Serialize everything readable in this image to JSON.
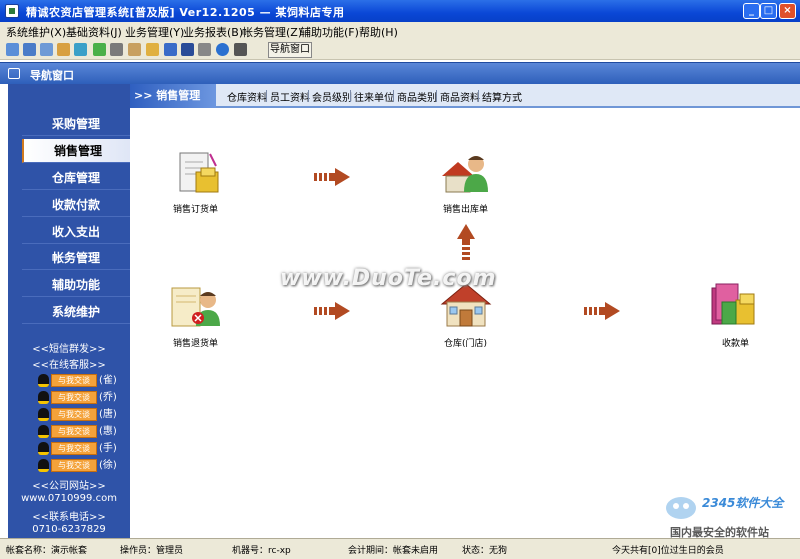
{
  "window": {
    "title": "精诚农资店管理系统[普及版] Ver12.1205 — 某饲料店专用"
  },
  "menubar": {
    "items": [
      "系统维护(X)",
      "基础资料(J)",
      "业务管理(Y)",
      "业务报表(B)",
      "帐务管理(Z)",
      "辅助功能(F)",
      "帮助(H)"
    ]
  },
  "toolbar": {
    "nav_button": "导航窗口"
  },
  "nav_window": {
    "title": "导航窗口"
  },
  "sidebar": {
    "items": [
      "采购管理",
      "销售管理",
      "仓库管理",
      "收款付款",
      "收入支出",
      "帐务管理",
      "辅助功能",
      "系统维护"
    ],
    "active_index": 1,
    "sms": "<<短信群发>>",
    "service": "<<在线客服>>",
    "qq_button": "与我交谈",
    "qq_names": [
      "(雀)",
      "(乔)",
      "(唐)",
      "(惠)",
      "(手)",
      "(徐)"
    ],
    "website_label": "<<公司网站>>",
    "website": "www.0710999.com",
    "phone_label": "<<联系电话>>",
    "phone": "0710-6237829"
  },
  "content": {
    "section": ">> 销售管理",
    "tabs": [
      "仓库资料",
      "员工资料",
      "会员级别",
      "往来单位",
      "商品类别",
      "商品资料",
      "结算方式"
    ]
  },
  "flow": {
    "sales_order": "销售订货单",
    "sales_outbound": "销售出库单",
    "sales_return": "销售退货单",
    "warehouse": "仓库(门店)",
    "receipt": "收款单"
  },
  "statusbar": {
    "account": "帐套名称：演示帐套",
    "operator": "操作员：管理员",
    "machine": "机器号：rc-xp",
    "period": "会计期间：帐套未启用",
    "state": "状态：无狗",
    "birthday": "今天共有[0]位过生日的会员"
  },
  "watermark": {
    "text": "www.DuoTe.com",
    "corner": "2345软件大全",
    "corner_sub": "国内最安全的软件站"
  },
  "colors": {
    "sidebar_bg": "#2f53a8",
    "titlebar": "#0a47d6",
    "arrow": "#b24a22"
  }
}
